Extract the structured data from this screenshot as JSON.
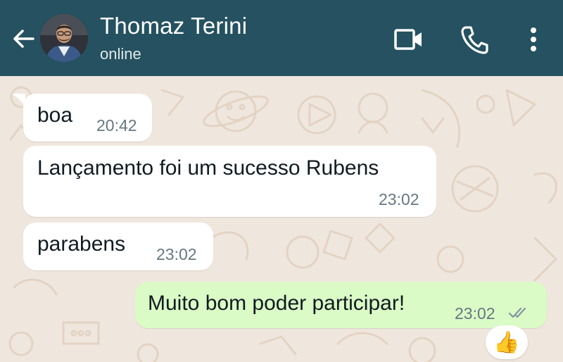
{
  "header": {
    "contact_name": "Thomaz Terini",
    "status": "online",
    "icons": [
      "back-arrow-icon",
      "video-call-icon",
      "phone-icon",
      "more-options-icon"
    ]
  },
  "messages": [
    {
      "direction": "incoming",
      "text": "boa",
      "time": "20:42"
    },
    {
      "direction": "incoming",
      "text": "Lançamento foi um sucesso Rubens",
      "time": "23:02"
    },
    {
      "direction": "incoming",
      "text": "parabens",
      "time": "23:02"
    },
    {
      "direction": "outgoing",
      "text": "Muito bom poder participar!",
      "time": "23:02",
      "status": "read",
      "reaction": "👍"
    }
  ],
  "colors": {
    "header": "#255160",
    "chat_background": "#efe7de",
    "incoming_bubble": "#ffffff",
    "outgoing_bubble": "#dafac6",
    "read_ticks": "#8696a0"
  }
}
